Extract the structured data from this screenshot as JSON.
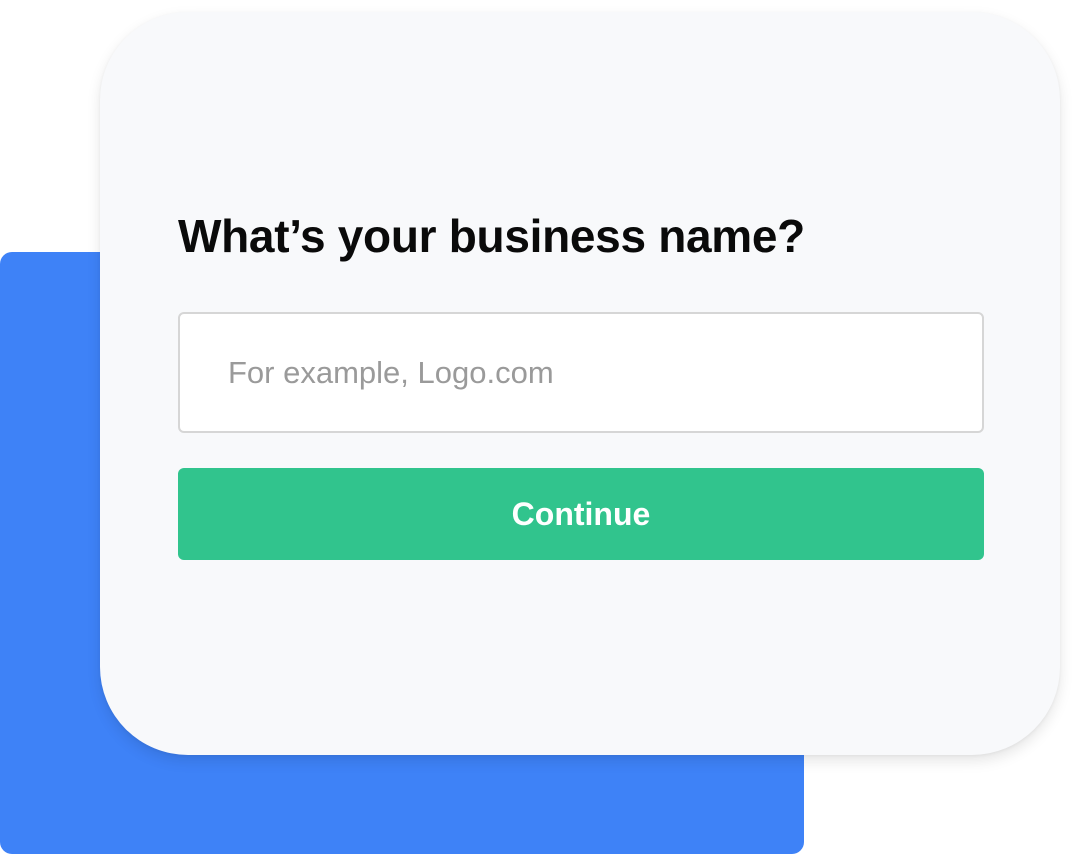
{
  "form": {
    "heading": "What’s your business name?",
    "input_value": "",
    "input_placeholder": "For example, Logo.com",
    "continue_label": "Continue"
  },
  "colors": {
    "backdrop": "#3e82f7",
    "card": "#f8f9fb",
    "button": "#31c48d",
    "button_text": "#ffffff",
    "heading_text": "#0a0a0a",
    "placeholder_text": "#9a9a9a"
  }
}
